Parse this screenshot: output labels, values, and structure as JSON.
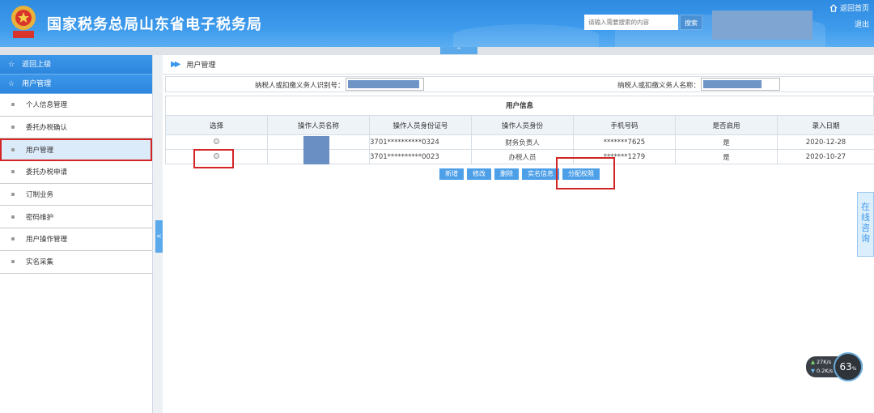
{
  "header": {
    "title": "国家税务总局山东省电子税务局",
    "search_placeholder": "请输入需要搜索的内容",
    "search_button": "搜索",
    "home_link": "返回首页",
    "logout_link": "退出",
    "collapse_arrow": "^"
  },
  "sidebar": {
    "back_label": "返回上级",
    "section_label": "用户管理",
    "items": [
      {
        "label": "个人信息管理"
      },
      {
        "label": "委托办税确认"
      },
      {
        "label": "用户管理",
        "active": true
      },
      {
        "label": "委托办税申请"
      },
      {
        "label": "订制业务"
      },
      {
        "label": "密码维护"
      },
      {
        "label": "用户操作管理"
      },
      {
        "label": "实名采集"
      }
    ],
    "collapse_handle": "<"
  },
  "main": {
    "breadcrumb": "用户管理",
    "filter": {
      "taxpayer_id_label": "纳税人或扣缴义务人识别号：",
      "taxpayer_name_label": "纳税人或扣缴义务人名称："
    },
    "table": {
      "title": "用户信息",
      "columns": [
        "选择",
        "操作人员名称",
        "操作人员身份证号",
        "操作人员身份",
        "手机号码",
        "是否启用",
        "录入日期"
      ],
      "rows": [
        {
          "id_number": "3701**********0324",
          "role": "财务负责人",
          "phone": "*******7625",
          "enabled": "是",
          "date": "2020-12-28"
        },
        {
          "id_number": "3701**********0023",
          "role": "办税人员",
          "phone": "*******1279",
          "enabled": "是",
          "date": "2020-10-27"
        }
      ]
    },
    "buttons": {
      "add": "新增",
      "edit": "修改",
      "delete": "删除",
      "realname": "实名信息",
      "assign": "分配权限"
    }
  },
  "consult": "在线咨询",
  "speed_widget": {
    "upload": "27",
    "upload_unit": "K/s",
    "download": "0.2",
    "download_unit": "K/s",
    "percent": "63",
    "percent_unit": "%"
  },
  "colors": {
    "header_blue": "#2f8be0",
    "accent": "#4d9fe8",
    "highlight_red": "#d32525"
  }
}
